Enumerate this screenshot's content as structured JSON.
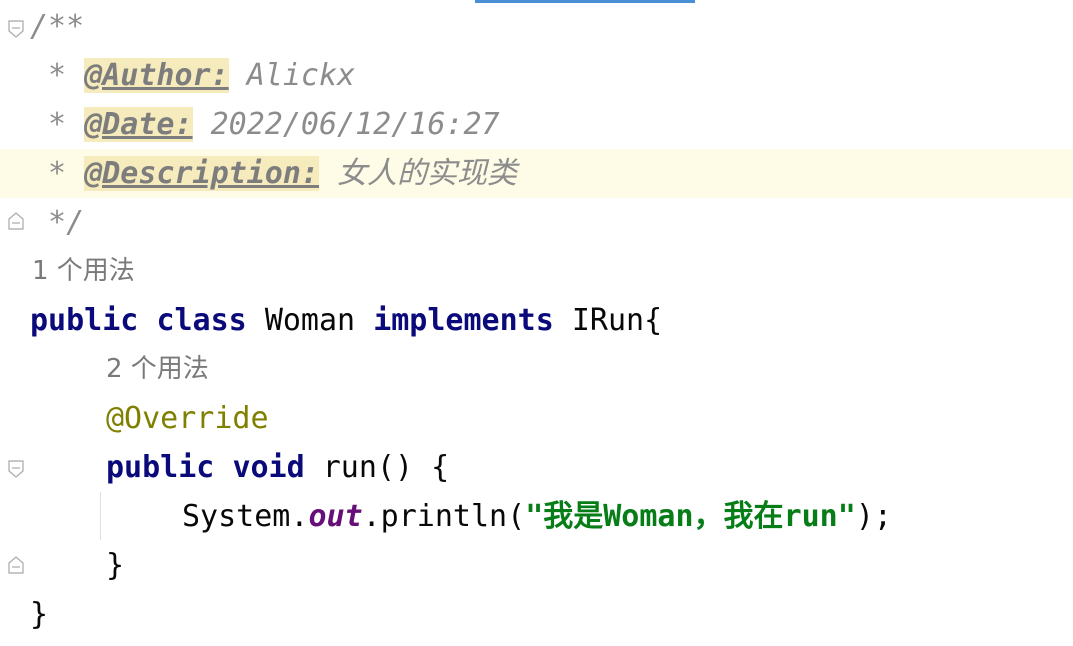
{
  "editor": {
    "doc_comment": {
      "open": "/**",
      "author_prefix": " * ",
      "author_tag": "@Author:",
      "author_value": " Alickx",
      "date_prefix": " * ",
      "date_tag": "@Date:",
      "date_value": " 2022/06/12/16:27",
      "desc_prefix": " * ",
      "desc_tag": "@Description:",
      "desc_value": " 女人的实现类",
      "close": " */"
    },
    "usage_hint_class": "1 个用法",
    "class_decl": {
      "kw_public": "public",
      "kw_class": "class",
      "name": "Woman",
      "kw_implements": "implements",
      "interface": "IRun{"
    },
    "usage_hint_method": "2 个用法",
    "annotation": "@Override",
    "method_decl": {
      "kw_public": "public",
      "kw_void": "void",
      "signature": "run() {"
    },
    "statement": {
      "receiver": "System.",
      "field": "out",
      "call": ".println(",
      "string_open": "\"我是",
      "string_woman": "Woman",
      "string_mid": "，我在",
      "string_run": "run",
      "string_close": "\"",
      "end": ");"
    },
    "method_close": "}",
    "class_close": "}"
  }
}
